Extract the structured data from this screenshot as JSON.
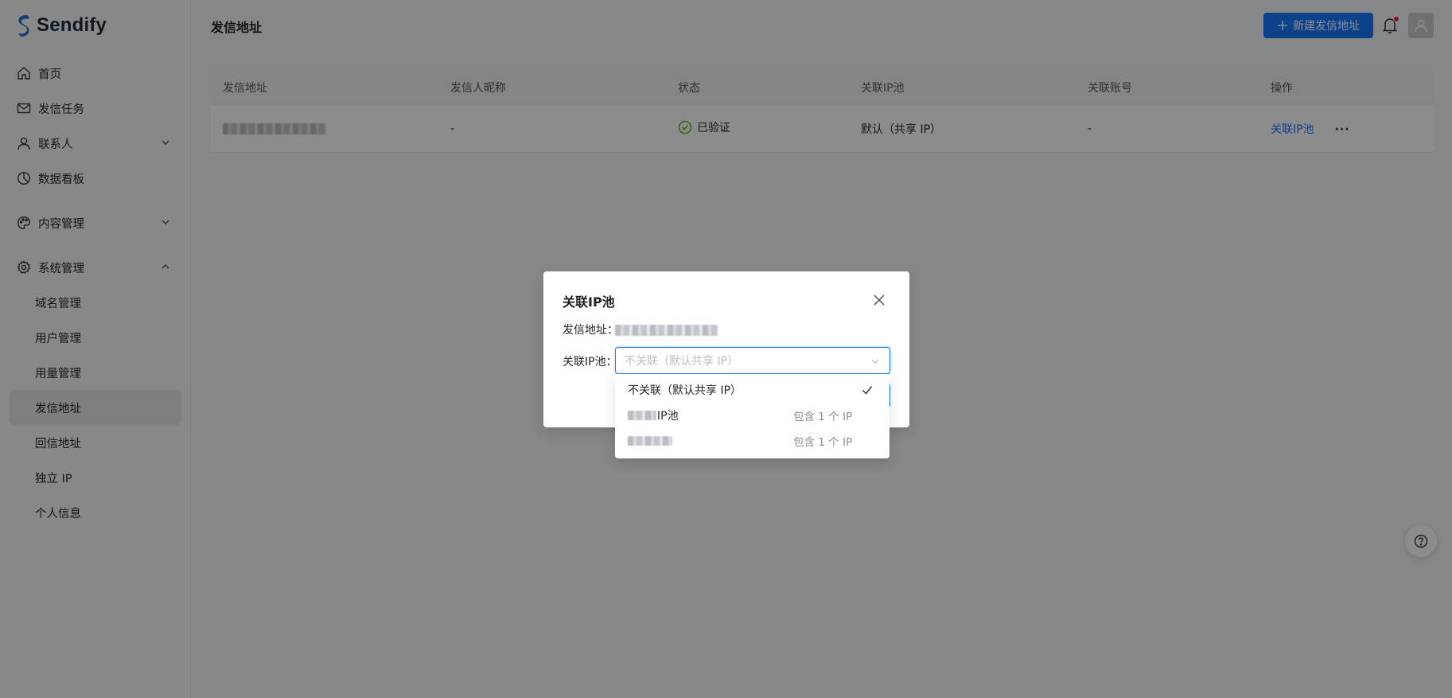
{
  "app": {
    "name": "Sendify"
  },
  "sidebar": {
    "items": [
      {
        "label": "首页",
        "icon": "home-icon"
      },
      {
        "label": "发信任务",
        "icon": "mail-icon"
      },
      {
        "label": "联系人",
        "icon": "user-icon",
        "expandable": true
      },
      {
        "label": "数据看板",
        "icon": "pie-chart-icon"
      },
      {
        "label": "内容管理",
        "icon": "palette-icon",
        "expandable": true
      },
      {
        "label": "系统管理",
        "icon": "settings-icon",
        "expanded": true
      }
    ],
    "sub_items": [
      {
        "label": "域名管理"
      },
      {
        "label": "用户管理"
      },
      {
        "label": "用量管理"
      },
      {
        "label": "发信地址",
        "active": true
      },
      {
        "label": "回信地址"
      },
      {
        "label": "独立 IP"
      },
      {
        "label": "个人信息"
      }
    ]
  },
  "header": {
    "title": "发信地址",
    "new_button_label": "新建发信地址"
  },
  "table": {
    "columns": [
      "发信地址",
      "发信人昵称",
      "状态",
      "关联IP池",
      "关联账号",
      "操作"
    ],
    "rows": [
      {
        "nickname": "-",
        "status": "已验证",
        "ip_pool": "默认（共享 IP）",
        "account": "-",
        "action": "关联IP池"
      }
    ]
  },
  "modal": {
    "title": "关联IP池",
    "address_label": "发信地址：",
    "pool_label": "关联IP池：",
    "select_placeholder": "不关联（默认共享 IP）",
    "options": [
      {
        "label": "不关联（默认共享 IP）",
        "selected": true,
        "sub": ""
      },
      {
        "label": "IP池",
        "sub": "包含 1 个 IP"
      },
      {
        "label": "",
        "sub": "包含 1 个 IP"
      }
    ]
  },
  "colors": {
    "primary": "#1677ff",
    "success": "#52c41a"
  }
}
